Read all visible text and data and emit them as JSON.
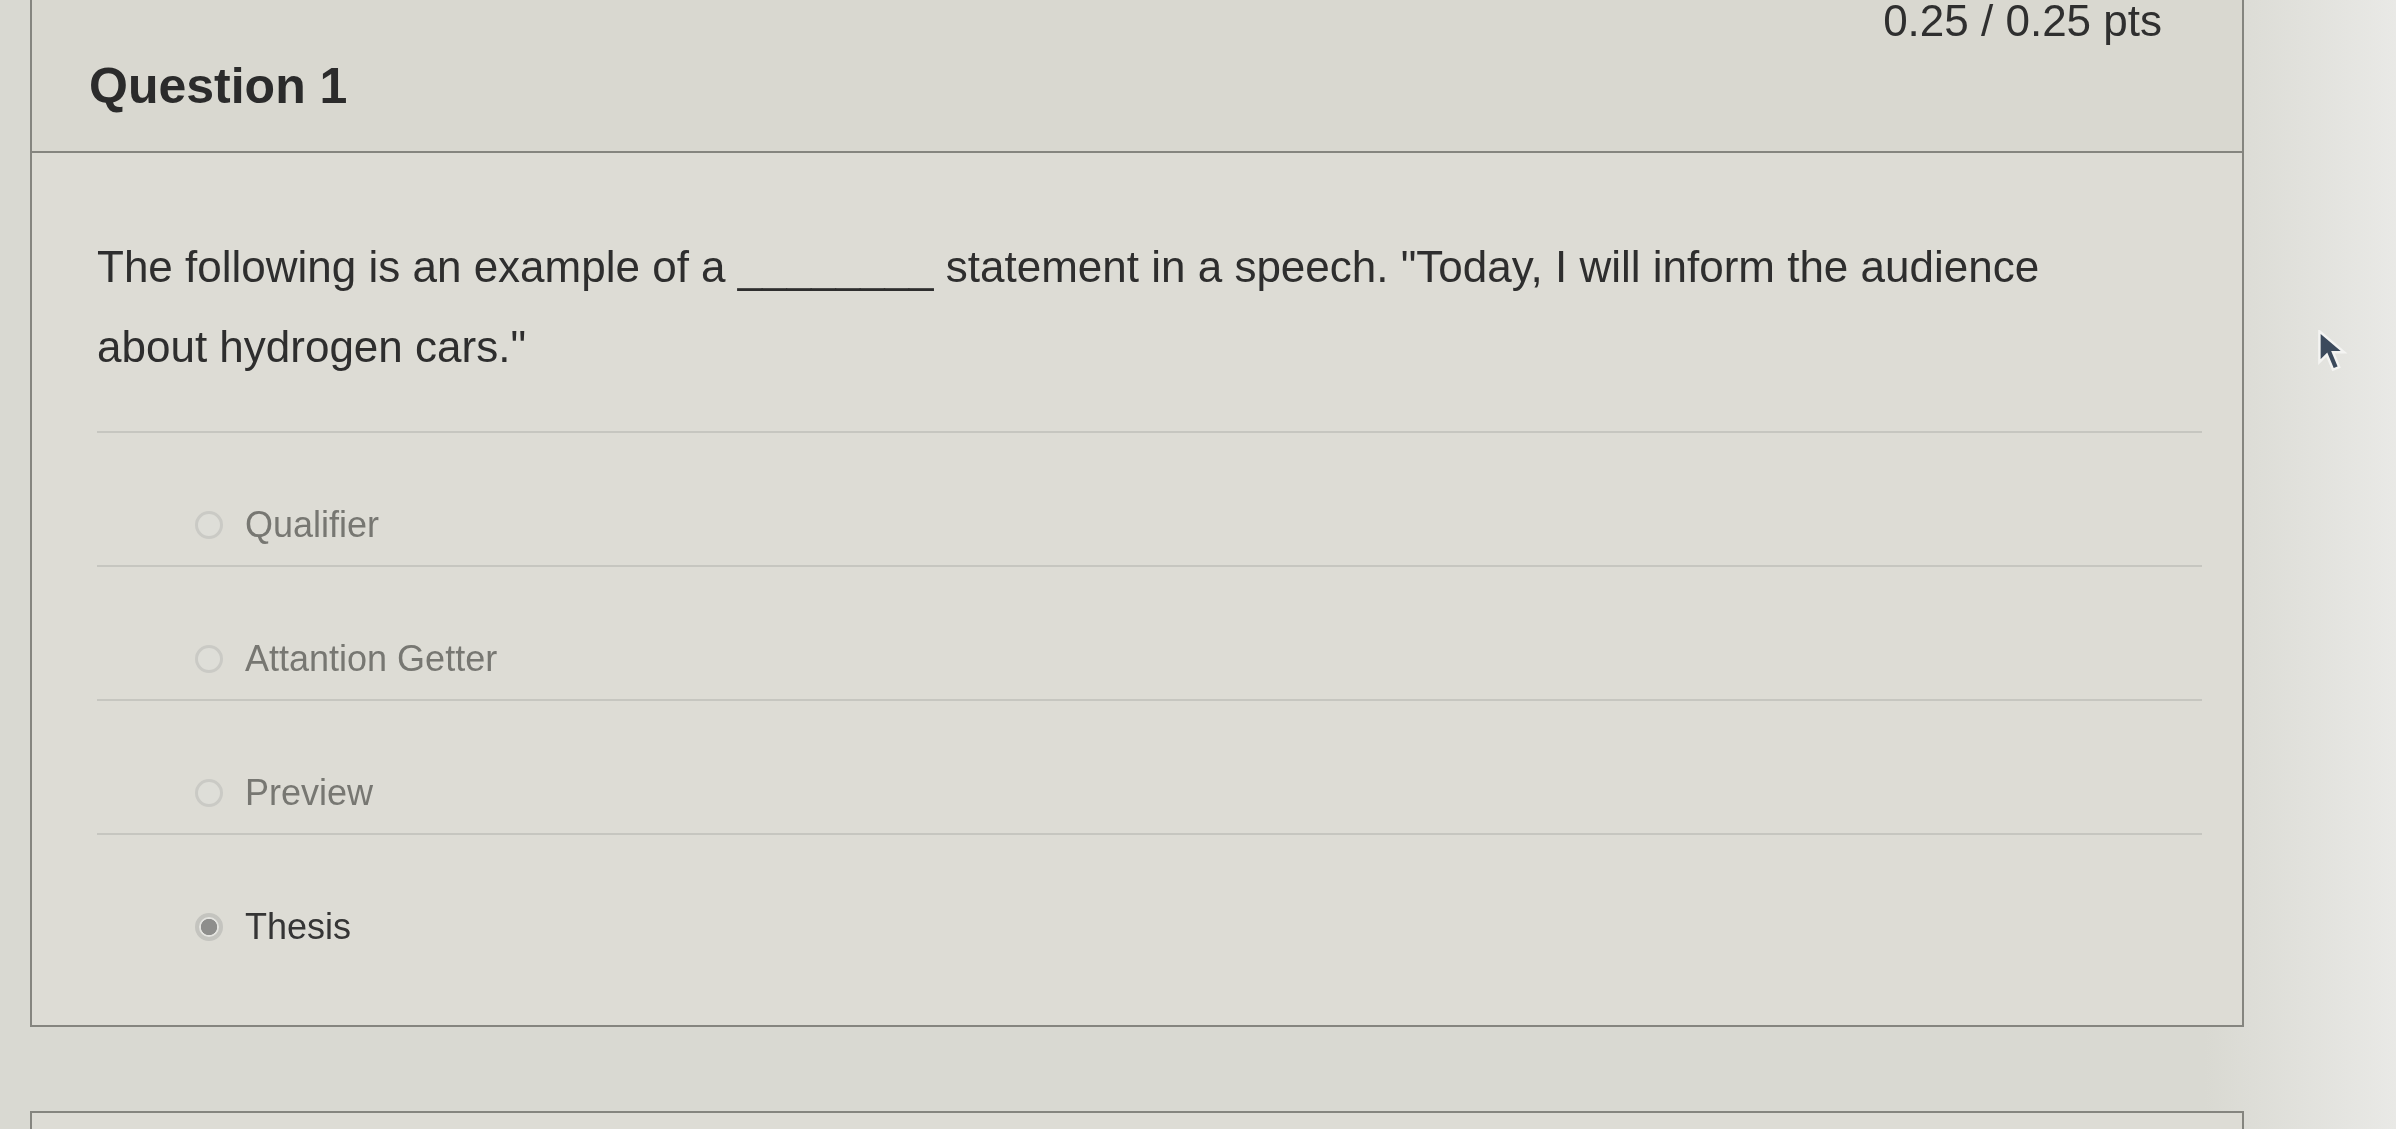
{
  "question": {
    "title": "Question 1",
    "points": "0.25 / 0.25 pts",
    "text": "The following is an example of a ________ statement in a speech. \"Today, I will inform the audience about hydrogen cars.\"",
    "answers": [
      {
        "label": "Qualifier",
        "selected": false
      },
      {
        "label": "Attantion Getter",
        "selected": false
      },
      {
        "label": "Preview",
        "selected": false
      },
      {
        "label": "Thesis",
        "selected": true
      }
    ]
  }
}
